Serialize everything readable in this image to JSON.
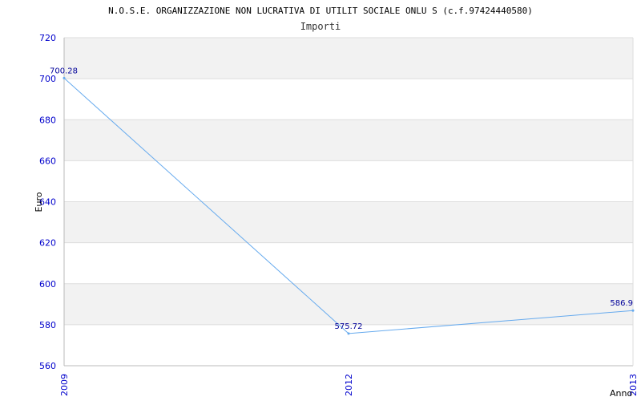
{
  "chart_data": {
    "type": "line",
    "title": "N.O.S.E. ORGANIZZAZIONE NON LUCRATIVA DI UTILIT SOCIALE ONLU S (c.f.97424440580)",
    "subtitle": "Importi",
    "xlabel": "Anno",
    "ylabel": "Euro",
    "x": [
      "2009",
      "2012",
      "2013"
    ],
    "series": [
      {
        "values": [
          700.28,
          575.72,
          586.9
        ],
        "labels": [
          "700.28",
          "575.72",
          "586.9"
        ]
      }
    ],
    "ylim": [
      560,
      720
    ],
    "yticks": [
      "560",
      "580",
      "600",
      "620",
      "640",
      "660",
      "680",
      "700",
      "720"
    ],
    "grid": true,
    "colors": {
      "line": "#66aaee",
      "band": "#f2f2f2",
      "grid": "#dddddd",
      "tick": "#0000cc",
      "label": "#000099"
    }
  }
}
